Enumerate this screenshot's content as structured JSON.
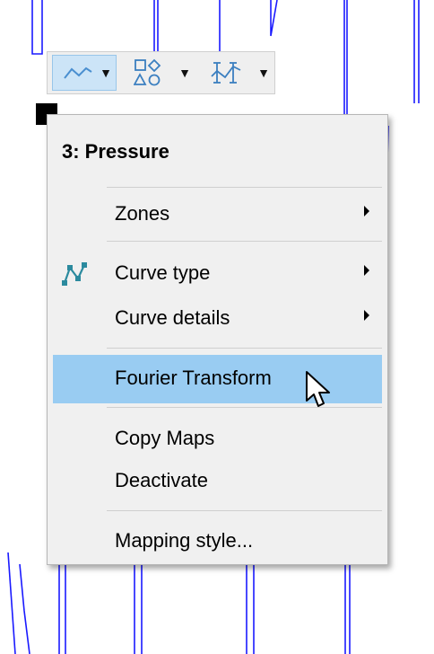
{
  "menu": {
    "title": "3: Pressure",
    "items": {
      "zones": {
        "label": "Zones"
      },
      "curve_type": {
        "label": "Curve type"
      },
      "curve_details": {
        "label": "Curve details"
      },
      "fourier_transform": {
        "label": "Fourier Transform"
      },
      "copy_maps": {
        "label": "Copy Maps"
      },
      "deactivate": {
        "label": "Deactivate"
      },
      "mapping_style": {
        "label": "Mapping style..."
      }
    }
  },
  "toolbar": {
    "buttons": [
      "line-style-icon",
      "shapes-icon",
      "error-bars-icon"
    ]
  },
  "colors": {
    "curve": "#1a1aff",
    "highlight": "#99ccf2",
    "menu_background": "#f0f0f0",
    "toolbar_active": "#cce4f7"
  }
}
